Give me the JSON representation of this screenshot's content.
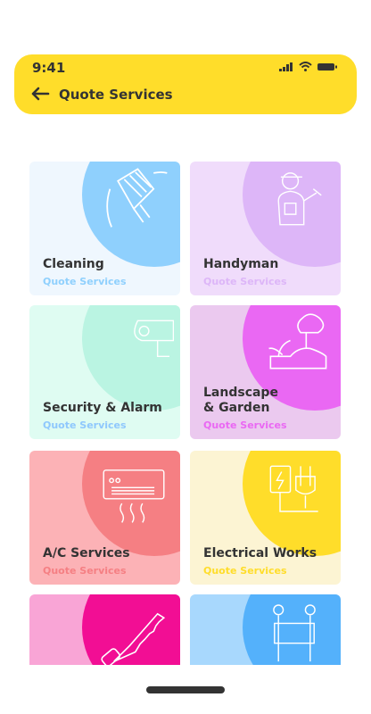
{
  "status_bar": {
    "time": "9:41"
  },
  "header": {
    "title": "Quote Services"
  },
  "cards": [
    {
      "name": "Cleaning",
      "subtitle": "Quote Services",
      "bg": "#EFF7FE",
      "circle": "#8FD0FD",
      "sub_color": "#8FD0FD",
      "icon": "cleaning-glove-icon"
    },
    {
      "name": "Handyman",
      "subtitle": "Quote Services",
      "bg": "#F0DCFB",
      "circle": "#DDB6F8",
      "sub_color": "#DDB6F8",
      "icon": "handyman-icon"
    },
    {
      "name": "Security & Alarm",
      "subtitle": "Quote Services",
      "bg": "#DFFCF2",
      "circle": "#BAF4E2",
      "sub_color": "#8FC8FD",
      "icon": "security-camera-icon"
    },
    {
      "name": "Landscape\n& Garden",
      "subtitle": "Quote Services",
      "bg": "#EBC9EF",
      "circle": "#EA68F3",
      "sub_color": "#EA68F3",
      "icon": "landscape-garden-icon"
    },
    {
      "name": "A/C Services",
      "subtitle": "Quote Services",
      "bg": "#FCB2B6",
      "circle": "#F57F83",
      "sub_color": "#F57F83",
      "icon": "air-conditioner-icon"
    },
    {
      "name": "Electrical Works",
      "subtitle": "Quote Services",
      "bg": "#FCF4D3",
      "circle": "#FFDD2A",
      "sub_color": "#FFDD2A",
      "icon": "electrical-plug-icon"
    },
    {
      "name": "",
      "subtitle": "",
      "bg": "#F9A5D6",
      "circle": "#F20E94",
      "sub_color": "#F20E94",
      "icon": "saw-icon"
    },
    {
      "name": "",
      "subtitle": "",
      "bg": "#A8D8FD",
      "circle": "#54B1FB",
      "sub_color": "#54B1FB",
      "icon": "movers-icon"
    }
  ]
}
